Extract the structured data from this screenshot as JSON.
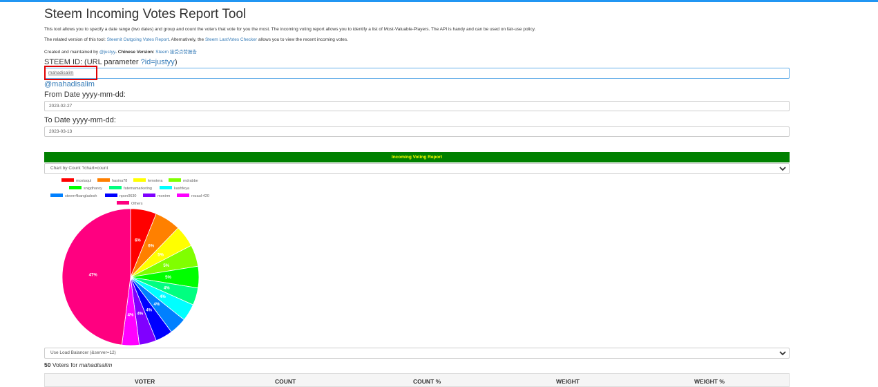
{
  "page": {
    "title": "Steem Incoming Votes Report Tool",
    "intro": "This tool allows you to specify a date range (two dates) and group and count the voters that vote for you the most. The incoming voting report allows you to identify a list of Most-Valuable-Players. The API is handy and can be used on fair-use policy.",
    "related_prefix": "The related version of this tool: ",
    "related_link": "Steemit Outgoing Votes Report",
    "related_mid": ". Alternatively, the ",
    "related_link2": "Steem LastVotes Checker",
    "related_suffix": " allows you to view the recent incoming votes.",
    "created_prefix": "Created and maintained by ",
    "created_author": "@justyy",
    "created_chinese_label": ". Chinese Version: ",
    "created_chinese_link": "Steem 接受点赞报告"
  },
  "form": {
    "steem_id_label": "STEEM ID: (URL parameter ",
    "steem_id_param": "?id=justyy",
    "steem_id_close": ")",
    "steem_id_value": "mahadisalim",
    "steem_id_link": "@mahadisalim",
    "from_label": "From Date yyyy-mm-dd:",
    "from_value": "2023-02-27",
    "to_label": "To Date yyyy-mm-dd:",
    "to_value": "2023-03-13"
  },
  "report": {
    "banner": "Incoming Voting Report",
    "chart_select": "Chart by Count ?chart=count",
    "server_select": "Use Load Balancer (&server=12)",
    "voters_count": "50",
    "voters_text": " Voters for ",
    "voters_user": "mahadisalim"
  },
  "table": {
    "headers": [
      "VOTER",
      "COUNT",
      "COUNT %",
      "WEIGHT",
      "WEIGHT %"
    ]
  },
  "chart_data": {
    "type": "pie",
    "title": "",
    "legend_position": "top",
    "slices": [
      {
        "name": "mostaqul",
        "label": "6%",
        "value": 6,
        "color": "#ff0000"
      },
      {
        "name": "hasina78",
        "label": "6%",
        "value": 6,
        "color": "#ff8000"
      },
      {
        "name": "lemotera",
        "label": "5%",
        "value": 5,
        "color": "#ffff00"
      },
      {
        "name": "mdrabbe",
        "label": "5%",
        "value": 5,
        "color": "#80ff00"
      },
      {
        "name": "snigdharoy",
        "label": "5%",
        "value": 5,
        "color": "#00ff00"
      },
      {
        "name": "fatemamarketing",
        "label": "4%",
        "value": 4,
        "color": "#00ff80"
      },
      {
        "name": "kashfeya",
        "label": "4%",
        "value": 4,
        "color": "#00ffff"
      },
      {
        "name": "steem4bangladesh",
        "label": "4%",
        "value": 4,
        "color": "#0080ff"
      },
      {
        "name": "npon0630",
        "label": "4%",
        "value": 4,
        "color": "#0000ff"
      },
      {
        "name": "monirm",
        "label": "4%",
        "value": 4,
        "color": "#8000ff"
      },
      {
        "name": "rezaul-420",
        "label": "4%",
        "value": 4,
        "color": "#ff00ff"
      },
      {
        "name": "Others",
        "label": "47%",
        "value": 47,
        "color": "#ff0080"
      }
    ]
  }
}
